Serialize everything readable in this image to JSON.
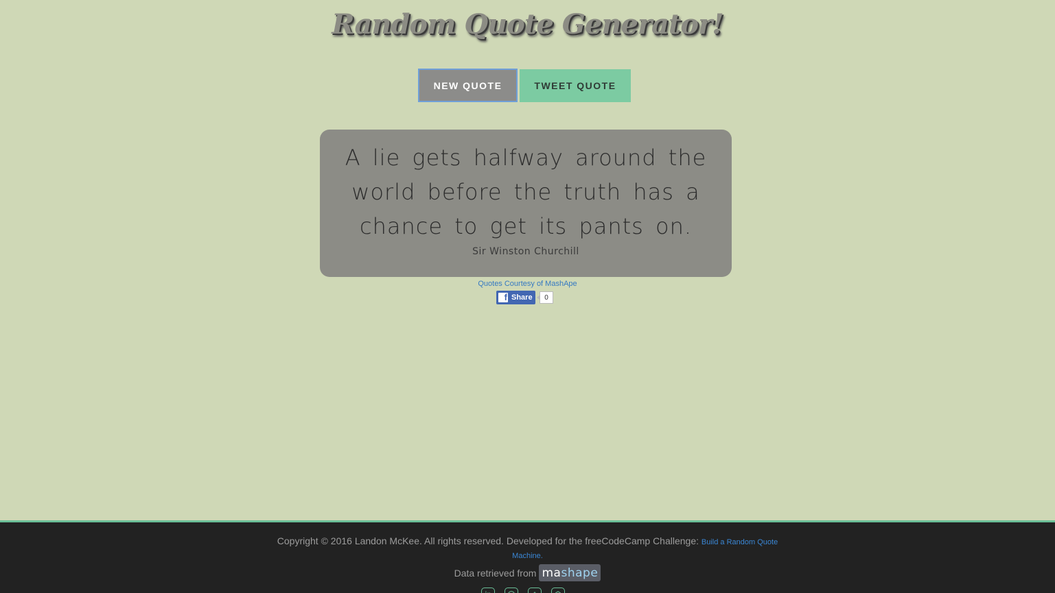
{
  "header": {
    "title": "Random Quote Generator!"
  },
  "buttons": {
    "new_quote": "NEW QUOTE",
    "tweet_quote": "TWEET QUOTE"
  },
  "quote": {
    "text": "A lie gets halfway around the world before the truth has a chance to get its pants on.",
    "author": "Sir Winston Churchill"
  },
  "courtesy": "Quotes Courtesy of MashApe",
  "share": {
    "label": "Share",
    "icon": "f",
    "count": "0"
  },
  "footer": {
    "copyright": "Copyright © 2016 Landon McKee. All rights reserved. Developed for the freeCodeCamp Challenge: ",
    "link_part1": "Build a Random Quote",
    "link_part2": "Machine.",
    "data_retrieved": "Data retrieved from",
    "mashape_ma": "ma",
    "mashape_shape": "shape",
    "social_icons": [
      "linkedin-icon",
      "github-icon",
      "twitter-icon",
      "codepen-icon"
    ],
    "social_glyphs": [
      "in",
      "◯",
      "t",
      "⬡"
    ]
  },
  "colors": {
    "background": "#cfd8b6",
    "accent": "#7ccba2",
    "quote_box": "#8c8c86",
    "footer": "#222222",
    "link": "#3579c2"
  }
}
